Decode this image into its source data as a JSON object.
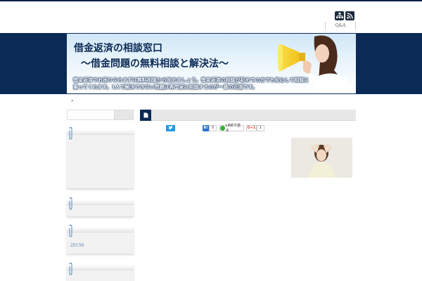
{
  "header": {
    "nav": [
      "Q&A"
    ],
    "icons": [
      "sitemap-icon",
      "rss-icon"
    ]
  },
  "banner": {
    "title_line1": "借金返済の相談窓口",
    "title_line2": "～借金問題の無料相談と解決法～",
    "description": "借金返済でお困りならまずは無料相談から始めましょう。借金返済の相談が初めての方でも安心して相談に乗ってくれます。1人で解決できない問題は専門家に相談するのが一番の近道です。"
  },
  "breadcrumb": {
    "text": "»"
  },
  "sidebar": {
    "search": {
      "placeholder": "",
      "button_label": ""
    },
    "widgets": [
      {
        "text": ""
      },
      {
        "text": ""
      },
      {
        "text": "20158"
      },
      {
        "text": ""
      }
    ]
  },
  "post": {
    "share": {
      "hatena_label": "B!",
      "hatena_count": "0",
      "line_label": "LINEで送る",
      "gplus_label": "G+1",
      "gplus_count": "1"
    }
  },
  "colors": {
    "navy": "#0b2a55",
    "twitter": "#1f9ae3",
    "hatena": "#2a73c9",
    "line": "#2bb52b",
    "gplus": "#dd4b39",
    "widget_link": "#5b7fb0"
  }
}
